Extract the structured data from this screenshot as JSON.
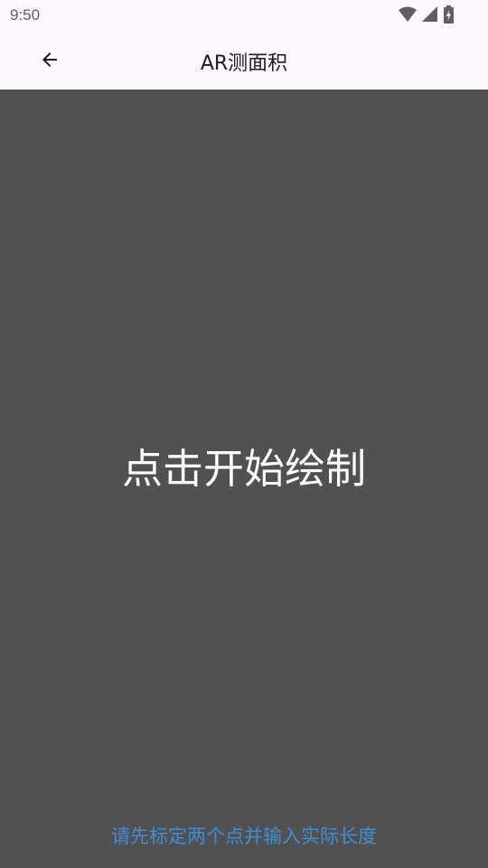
{
  "status_bar": {
    "time": "9:50",
    "icons": [
      "wifi-icon",
      "signal-icon",
      "battery-icon"
    ]
  },
  "app_bar": {
    "back_icon": "arrow-left-icon",
    "title": "AR测面积"
  },
  "canvas": {
    "center_text": "点击开始绘制",
    "hint_text": "请先标定两个点并输入实际长度"
  },
  "colors": {
    "background": "#fdf8fd",
    "canvas": "#515151",
    "hint": "#3b8fd6",
    "title": "#1c1b1f"
  }
}
